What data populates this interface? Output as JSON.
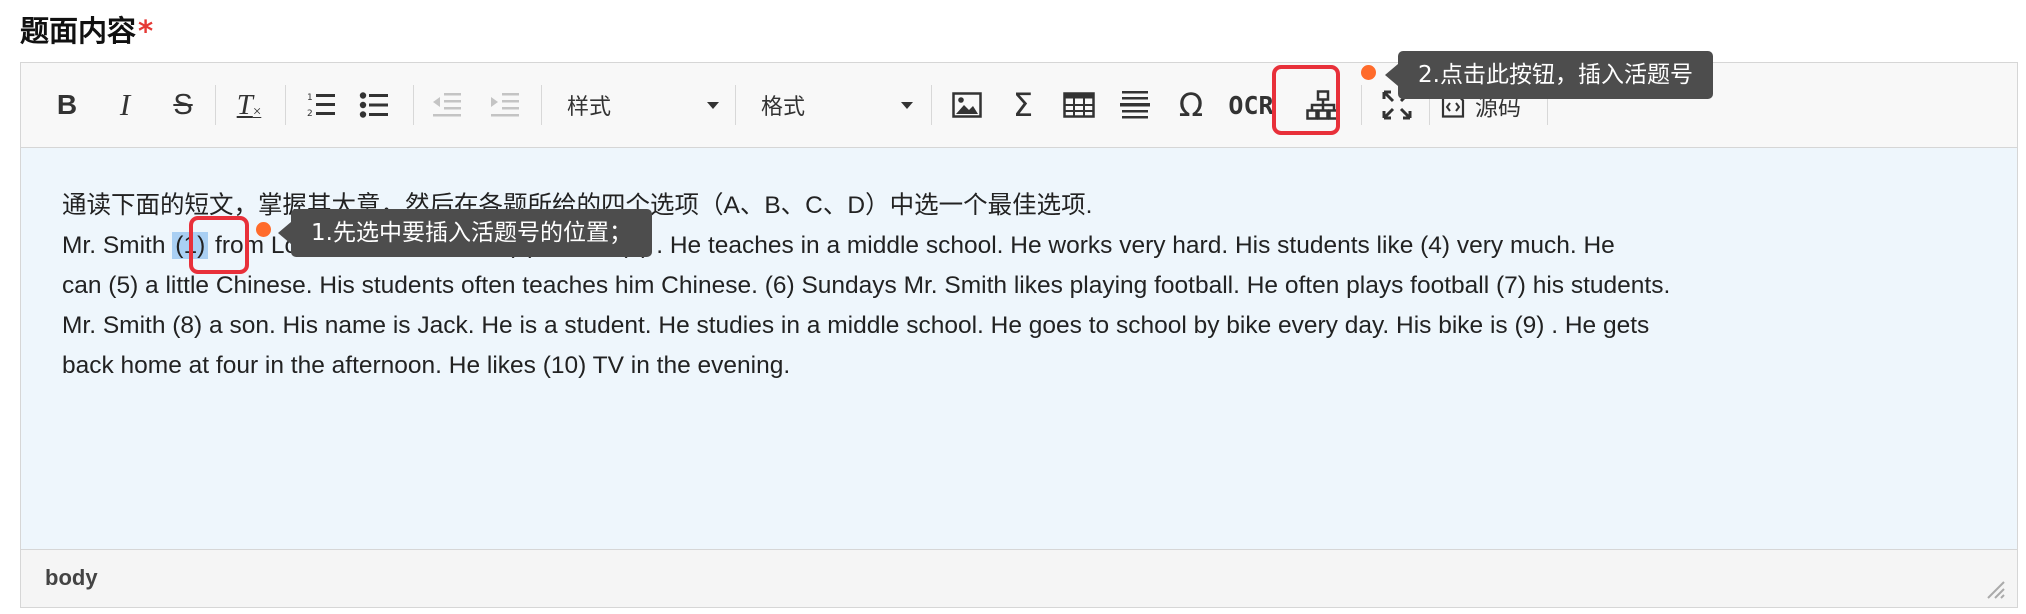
{
  "field": {
    "label": "题面内容",
    "required_mark": "*"
  },
  "toolbar": {
    "bold": "B",
    "italic": "I",
    "strikethrough": "S",
    "remove_format": "T",
    "style_combo": "样式",
    "format_combo": "格式",
    "ocr": "OCR",
    "source_label": "源码"
  },
  "content": {
    "lines": [
      "通读下面的短文，掌握其大意，然后在各题所给的四个选项（A、B、C、D）中选一个最佳选项.",
      "Mr.  Smith",
      " from London.  Now he is in (2) .  He is (3) .  He teaches in a middle school.  He works very hard.  His students like (4) very much.  He",
      "can (5) a little Chinese.  His students often teaches him Chinese.   (6) Sundays Mr.  Smith likes playing football.  He often plays football (7) his students.",
      "Mr.  Smith (8) a son.  His name is Jack.  He is a student.  He studies in a middle school.  He goes to school by bike every day.  His bike is (9) .  He gets",
      "back home at four in the afternoon.  He likes (10) TV in the evening."
    ],
    "selected_blank": "(1)"
  },
  "statusbar": {
    "path": "body"
  },
  "tips": {
    "step1": "1.先选中要插入活题号的位置；",
    "step2": "2.点击此按钮，插入活题号"
  },
  "colors": {
    "highlight": "#e8303a",
    "marker": "#ff6b2b",
    "tooltip_bg": "#4d4d4d",
    "selection": "#a9cff3",
    "content_bg": "#eef6fc"
  }
}
